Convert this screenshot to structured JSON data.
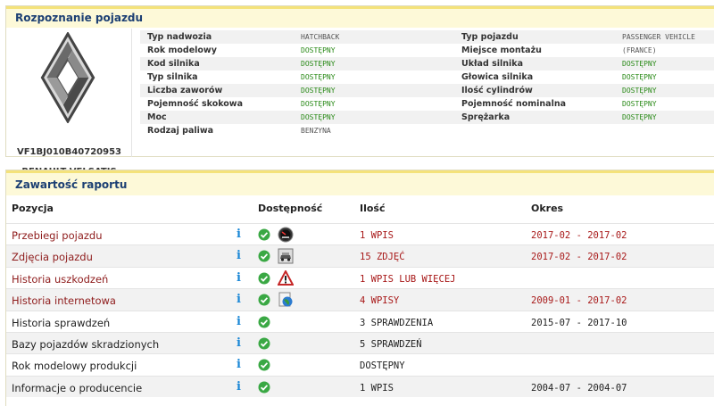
{
  "identification": {
    "title": "Rozpoznanie pojazdu",
    "vin": "VF1BJ010B40720953",
    "model": "RENAULT VELSATIS",
    "logo_icon": "renault-logo-icon",
    "specs": [
      {
        "k1": "Typ nadwozia",
        "v1": "HATCHBACK",
        "v1c": "gray",
        "k2": "Typ pojazdu",
        "v2": "PASSENGER VEHICLE",
        "v2c": "gray"
      },
      {
        "k1": "Rok modelowy",
        "v1": "DOSTĘPNY",
        "v1c": "green",
        "k2": "Miejsce montażu",
        "v2": "(FRANCE)",
        "v2c": "gray"
      },
      {
        "k1": "Kod silnika",
        "v1": "DOSTĘPNY",
        "v1c": "green",
        "k2": "Układ silnika",
        "v2": "DOSTĘPNY",
        "v2c": "green"
      },
      {
        "k1": "Typ silnika",
        "v1": "DOSTĘPNY",
        "v1c": "green",
        "k2": "Głowica silnika",
        "v2": "DOSTĘPNY",
        "v2c": "green"
      },
      {
        "k1": "Liczba zaworów",
        "v1": "DOSTĘPNY",
        "v1c": "green",
        "k2": "Ilość cylindrów",
        "v2": "DOSTĘPNY",
        "v2c": "green"
      },
      {
        "k1": "Pojemność skokowa",
        "v1": "DOSTĘPNY",
        "v1c": "green",
        "k2": "Pojemność nominalna",
        "v2": "DOSTĘPNY",
        "v2c": "green"
      },
      {
        "k1": "Moc",
        "v1": "DOSTĘPNY",
        "v1c": "green",
        "k2": "Sprężarka",
        "v2": "DOSTĘPNY",
        "v2c": "green"
      },
      {
        "k1": "Rodzaj paliwa",
        "v1": "BENZYNA",
        "v1c": "gray",
        "k2": "",
        "v2": "",
        "v2c": "gray"
      }
    ]
  },
  "report": {
    "title": "Zawartość raportu",
    "headers": {
      "position": "Pozycja",
      "availability": "Dostępność",
      "quantity": "Ilość",
      "period": "Okres"
    },
    "rows": [
      {
        "name": "Przebiegi pojazdu",
        "qty": "1 WPIS",
        "period": "2017-02 - 2017-02",
        "tone": "red",
        "icon": "odometer-icon"
      },
      {
        "name": "Zdjęcia pojazdu",
        "qty": "15 ZDJĘĆ",
        "period": "2017-02 - 2017-02",
        "tone": "red",
        "icon": "car-photo-icon"
      },
      {
        "name": "Historia uszkodzeń",
        "qty": "1 WPIS LUB WIĘCEJ",
        "period": "",
        "tone": "red",
        "icon": "warning-icon"
      },
      {
        "name": "Historia internetowa",
        "qty": "4 WPISY",
        "period": "2009-01 - 2017-02",
        "tone": "red",
        "icon": "globe-icon"
      },
      {
        "name": "Historia sprawdzeń",
        "qty": "3 SPRAWDZENIA",
        "period": "2015-07 - 2017-10",
        "tone": "dark",
        "icon": ""
      },
      {
        "name": "Bazy pojazdów skradzionych",
        "qty": "5 SPRAWDZEŃ",
        "period": "",
        "tone": "dark",
        "icon": ""
      },
      {
        "name": "Rok modelowy produkcji",
        "qty": "DOSTĘPNY",
        "period": "",
        "tone": "dark",
        "icon": ""
      },
      {
        "name": "Informacje o producencie",
        "qty": "1 WPIS",
        "period": "2004-07 - 2004-07",
        "tone": "dark",
        "icon": ""
      }
    ],
    "info_icon": "info-icon",
    "ok_icon": "check-circle-icon"
  },
  "colors": {
    "accent": "#1c3f73",
    "header_bg": "#fdf9d8",
    "header_border": "#f4e27a",
    "available": "#2a8a18",
    "highlight": "#a81919",
    "info": "#1a87d6"
  }
}
